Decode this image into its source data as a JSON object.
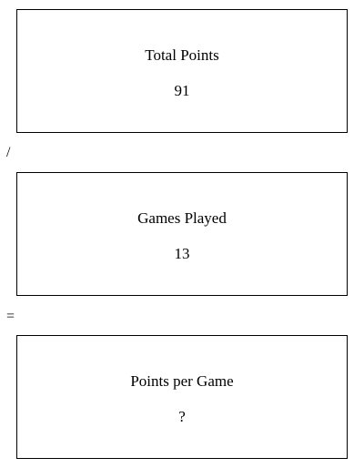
{
  "cards": [
    {
      "title": "Total Points",
      "value": "91"
    },
    {
      "title": "Games Played",
      "value": "13"
    },
    {
      "title": "Points per Game",
      "value": "?"
    }
  ],
  "operators": [
    "/",
    "="
  ]
}
